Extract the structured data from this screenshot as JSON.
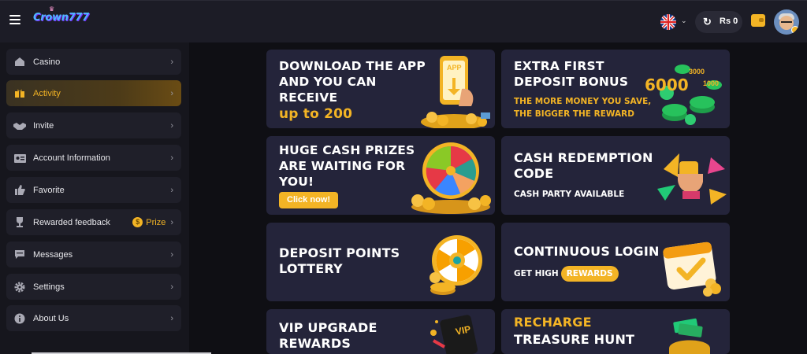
{
  "header": {
    "logo_text": "Crown777",
    "balance": "Rs 0",
    "language_chevron": "⌄"
  },
  "sidebar": {
    "items": [
      {
        "label": "Casino",
        "icon": "house-icon",
        "active": false
      },
      {
        "label": "Activity",
        "icon": "gift-icon",
        "active": true
      },
      {
        "label": "Invite",
        "icon": "handshake-icon",
        "active": false
      },
      {
        "label": "Account Information",
        "icon": "id-card-icon",
        "active": false
      },
      {
        "label": "Favorite",
        "icon": "thumbs-up-icon",
        "active": false
      },
      {
        "label": "Rewarded feedback",
        "icon": "trophy-icon",
        "active": false,
        "badge": "Prize"
      },
      {
        "label": "Messages",
        "icon": "message-icon",
        "active": false
      },
      {
        "label": "Settings",
        "icon": "gear-icon",
        "active": false
      },
      {
        "label": "About Us",
        "icon": "info-icon",
        "active": false
      }
    ]
  },
  "cards": {
    "download": {
      "title": "DOWNLOAD THE APP\nAND YOU CAN\nRECEIVE",
      "highlight": "up to 200",
      "app_label": "APP"
    },
    "deposit_bonus": {
      "title": "EXTRA FIRST\nDEPOSIT BONUS",
      "sub_line1": "THE MORE MONEY YOU SAVE,",
      "sub_line2": "THE BIGGER THE REWARD",
      "chip_values": [
        "6000",
        "3000",
        "1000"
      ]
    },
    "cash_prizes": {
      "title": "HUGE CASH PRIZES\nARE WAITING FOR\nYOU!",
      "button": "Click now!"
    },
    "redemption": {
      "title": "CASH REDEMPTION\nCODE",
      "sub": "CASH PARTY AVAILABLE"
    },
    "lottery": {
      "title": "DEPOSIT POINTS\nLOTTERY"
    },
    "login": {
      "title": "CONTINUOUS LOGIN",
      "sub": "GET HIGH",
      "pill": "REWARDS"
    },
    "vip": {
      "title": "VIP UPGRADE\nREWARDS",
      "badge": "VIP"
    },
    "recharge": {
      "title_line1": "RECHARGE",
      "title_line2": "TREASURE HUNT"
    }
  },
  "colors": {
    "accent": "#f3b425",
    "card_bg": "#24243a",
    "page_bg": "#0f0f14",
    "sidebar_bg": "#16161d"
  }
}
